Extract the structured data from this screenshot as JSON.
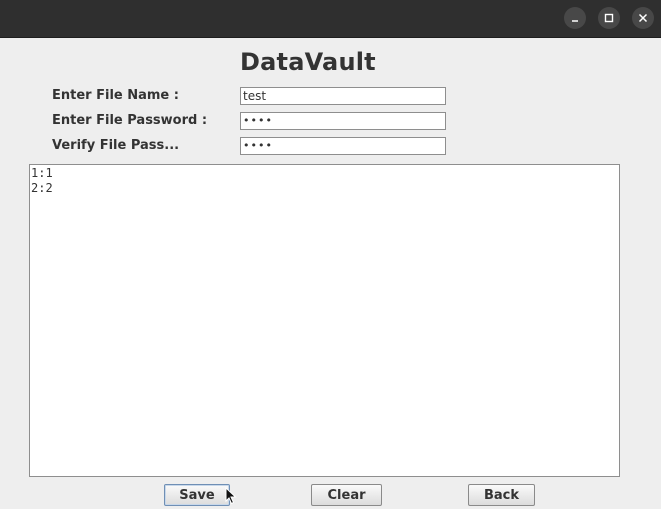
{
  "titlebar": {
    "buttons": [
      {
        "name": "minimize",
        "icon": "minimize-icon"
      },
      {
        "name": "maximize",
        "icon": "maximize-icon"
      },
      {
        "name": "close",
        "icon": "close-icon"
      }
    ]
  },
  "app": {
    "title": "DataVault"
  },
  "form": {
    "file_name_label": "Enter File Name :",
    "file_name_value": "test",
    "password_label": "Enter File Password :",
    "password_value": "••••",
    "verify_label": "Verify File Pass...",
    "verify_value": "••••"
  },
  "content_area": {
    "lines": [
      "1:1",
      "2:2"
    ]
  },
  "buttons": {
    "save_label": "Save",
    "clear_label": "Clear",
    "back_label": "Back"
  },
  "colors": {
    "titlebar": "#2f2f2f",
    "window_bg": "#eeeeee",
    "text": "#333333",
    "field_border": "#8e8e8e"
  }
}
